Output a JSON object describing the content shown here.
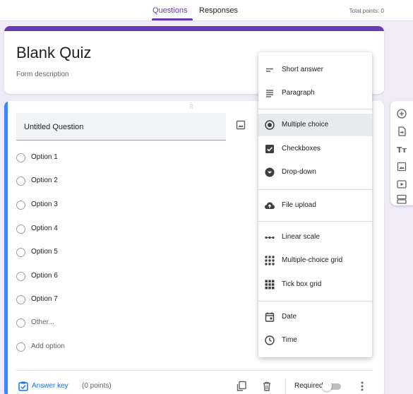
{
  "topbar": {
    "tabs": [
      "Questions",
      "Responses"
    ],
    "active_tab": "Questions",
    "total_points": "Total points: 0"
  },
  "form": {
    "title": "Blank Quiz",
    "description_placeholder": "Form description"
  },
  "question": {
    "title": "Untitled Question",
    "options": [
      "Option 1",
      "Option 2",
      "Option 3",
      "Option 4",
      "Option 5",
      "Option 6",
      "Option 7"
    ],
    "other_label": "Other...",
    "add_option_label": "Add option"
  },
  "footer": {
    "answer_key_label": "Answer key",
    "points_label": "(0 points)",
    "required_label": "Required",
    "required_enabled": false
  },
  "type_menu": {
    "items": [
      {
        "label": "Short answer",
        "icon": "short-answer-icon"
      },
      {
        "label": "Paragraph",
        "icon": "paragraph-icon"
      },
      {
        "label": "Multiple choice",
        "icon": "radio-checked-icon"
      },
      {
        "label": "Checkboxes",
        "icon": "checkbox-icon"
      },
      {
        "label": "Drop-down",
        "icon": "dropdown-circle-icon"
      },
      {
        "label": "File upload",
        "icon": "cloud-upload-icon"
      },
      {
        "label": "Linear scale",
        "icon": "linear-scale-icon"
      },
      {
        "label": "Multiple-choice grid",
        "icon": "dot-grid-icon"
      },
      {
        "label": "Tick box grid",
        "icon": "square-grid-icon"
      },
      {
        "label": "Date",
        "icon": "calendar-icon"
      },
      {
        "label": "Time",
        "icon": "clock-icon"
      }
    ],
    "selected": "Multiple choice"
  },
  "side_toolbar": {
    "icons": [
      "add-question-icon",
      "import-questions-icon",
      "add-title-icon",
      "add-image-icon",
      "add-video-icon",
      "add-section-icon"
    ]
  },
  "colors": {
    "accent": "#673ab7",
    "question_accent": "#4285f4",
    "link": "#1a73e8",
    "page_bg": "#f0ebf8"
  }
}
